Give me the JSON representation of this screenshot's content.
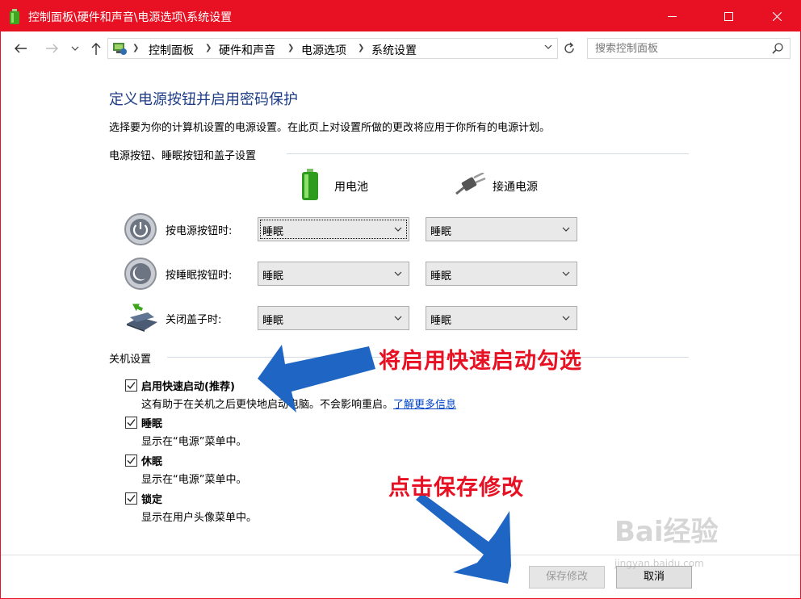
{
  "window": {
    "title": "控制面板\\硬件和声音\\电源选项\\系统设置"
  },
  "address": {
    "breadcrumbs": [
      "控制面板",
      "硬件和声音",
      "电源选项",
      "系统设置"
    ],
    "search_placeholder": "搜索控制面板"
  },
  "page": {
    "title": "定义电源按钮并启用密码保护",
    "description": "选择要为你的计算机设置的电源设置。在此页上对设置所做的更改将应用于你所有的电源计划。"
  },
  "power_section": {
    "label": "电源按钮、睡眠按钮和盖子设置",
    "col_battery": "用电池",
    "col_plugged": "接通电源",
    "rows": [
      {
        "label": "按电源按钮时:",
        "battery": "睡眠",
        "plugged": "睡眠"
      },
      {
        "label": "按睡眠按钮时:",
        "battery": "睡眠",
        "plugged": "睡眠"
      },
      {
        "label": "关闭盖子时:",
        "battery": "睡眠",
        "plugged": "睡眠"
      }
    ]
  },
  "shutdown_section": {
    "label": "关机设置",
    "items": [
      {
        "title": "启用快速启动(推荐)",
        "desc": "这有助于在关机之后更快地启动电脑。不会影响重启。",
        "link": "了解更多信息",
        "checked": true
      },
      {
        "title": "睡眠",
        "desc": "显示在“电源”菜单中。",
        "checked": true
      },
      {
        "title": "休眠",
        "desc": "显示在“电源”菜单中。",
        "checked": true
      },
      {
        "title": "锁定",
        "desc": "显示在用户头像菜单中。",
        "checked": true
      }
    ]
  },
  "buttons": {
    "save": "保存修改",
    "cancel": "取消"
  },
  "annotations": {
    "fast_startup": "将启用快速启动勾选",
    "save": "点击保存修改"
  },
  "watermark": {
    "text": "Bai经验",
    "sub": "jingyan.baidu.com"
  },
  "colors": {
    "titlebar": "#e81123",
    "heading": "#1e3d87",
    "annotation": "#e81123",
    "arrow": "#1f66c4",
    "link": "#0044cc"
  },
  "icons": [
    "battery-icon",
    "plug-icon",
    "power-button-icon",
    "sleep-button-icon",
    "laptop-lid-icon",
    "search-icon",
    "refresh-icon"
  ]
}
